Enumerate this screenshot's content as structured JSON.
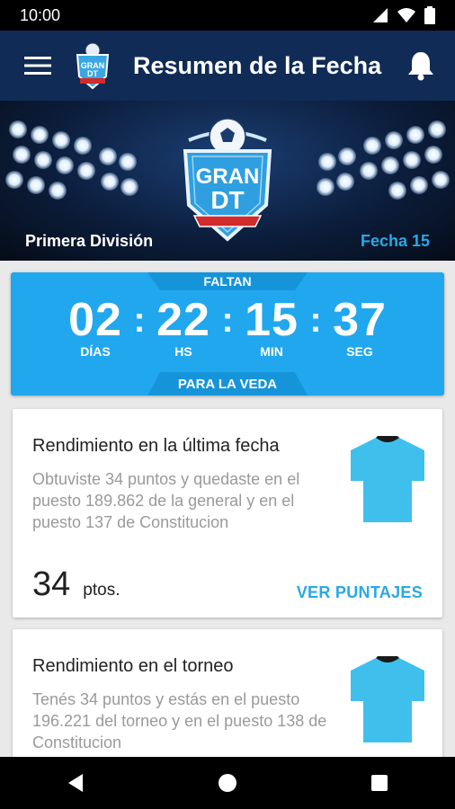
{
  "status_bar": {
    "time": "10:00",
    "icons": [
      "signal-icon",
      "wifi-icon",
      "battery-icon"
    ]
  },
  "app_bar": {
    "title": "Resumen de la Fecha",
    "menu_icon": "menu-icon",
    "notification_icon": "bell-icon"
  },
  "hero": {
    "logo_text": "GRAN DT",
    "league": "Primera División",
    "round": "Fecha 15"
  },
  "countdown": {
    "top_label": "FALTAN",
    "bottom_label": "PARA LA VEDA",
    "units": [
      {
        "value": "02",
        "label": "DÍAS"
      },
      {
        "value": "22",
        "label": "HS"
      },
      {
        "value": "15",
        "label": "MIN"
      },
      {
        "value": "37",
        "label": "SEG"
      }
    ],
    "separator": ":"
  },
  "cards": [
    {
      "title": "Rendimiento en la última fecha",
      "description": "Obtuviste 34 puntos y quedaste en el puesto 189.862 de la general y en el puesto 137 de Constitucion",
      "points": "34",
      "points_unit": "ptos.",
      "action": "VER PUNTAJES"
    },
    {
      "title": "Rendimiento en el torneo",
      "description": "Tenés 34 puntos y estás en el puesto 196.221 del torneo y en el puesto 138 de Constitucion"
    }
  ],
  "colors": {
    "app_bar": "#102b55",
    "accent": "#29a8e6",
    "countdown_bg": "#21a7ee",
    "shirt": "#3fc0ec"
  }
}
